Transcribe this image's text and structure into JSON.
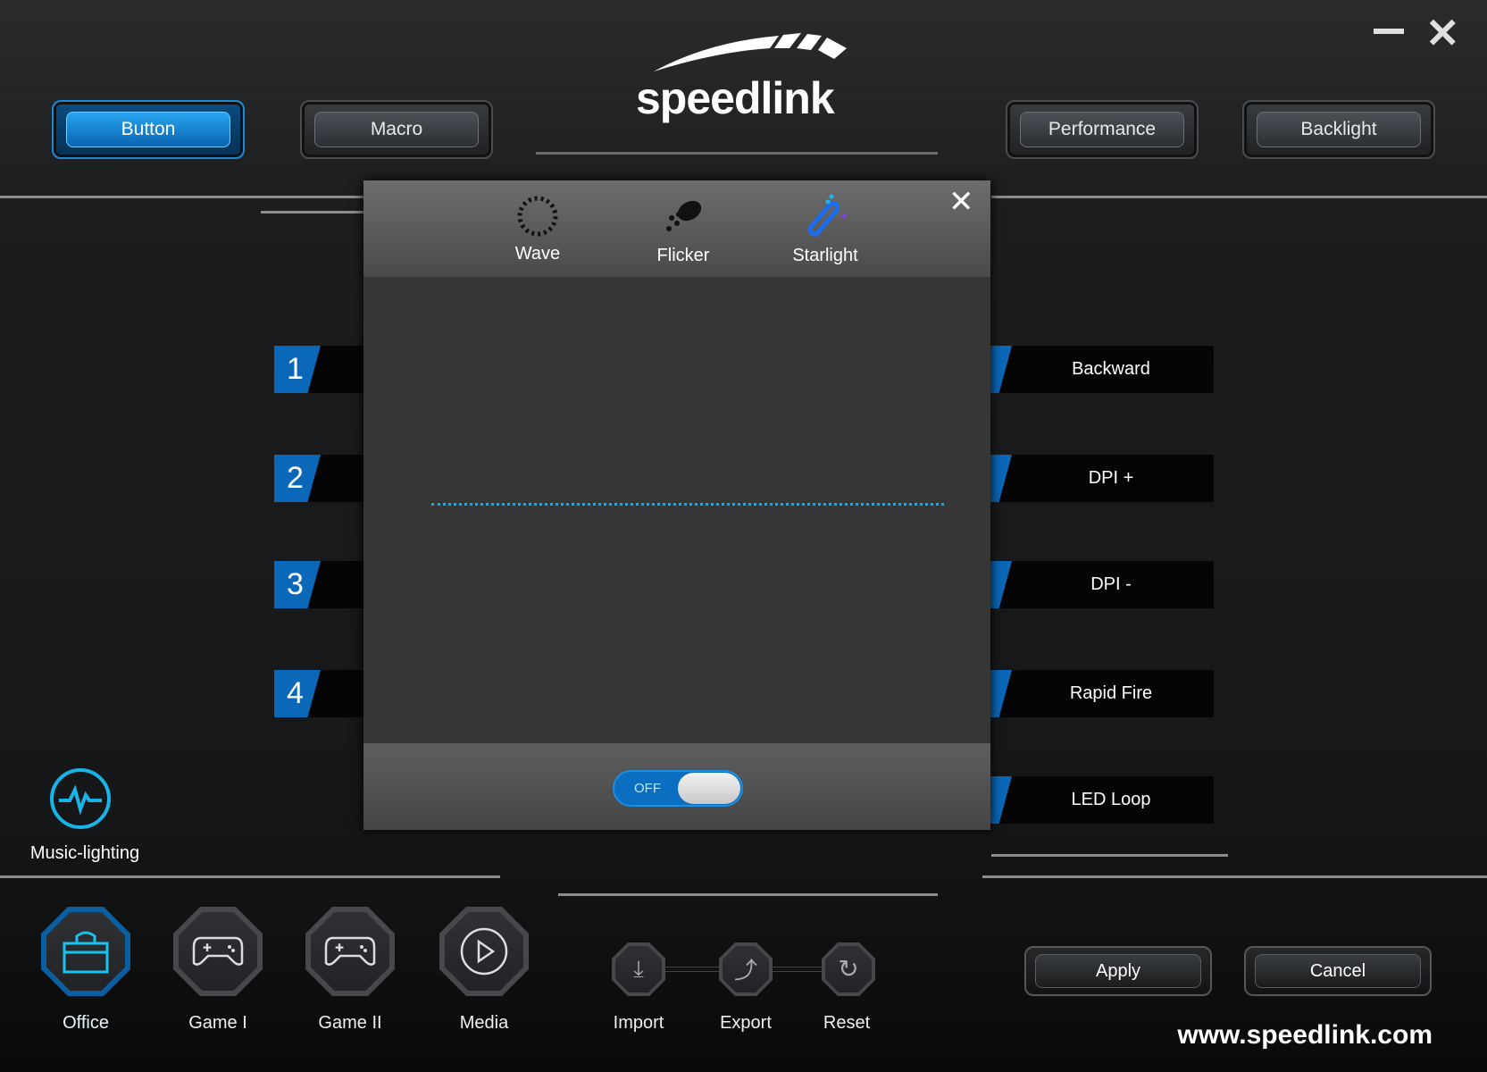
{
  "app": {
    "logo": "speedlink",
    "website": "www.speedlink.com"
  },
  "window": {
    "minimize_icon": "minimize-icon",
    "close_icon": "close-icon"
  },
  "tabs": [
    {
      "label": "Button",
      "active": true
    },
    {
      "label": "Macro"
    },
    {
      "label": "Performance"
    },
    {
      "label": "Backlight"
    }
  ],
  "left_buttons": [
    "1",
    "2",
    "3",
    "4"
  ],
  "right_buttons": [
    "Backward",
    "DPI +",
    "DPI -",
    "Rapid Fire",
    "LED Loop"
  ],
  "dialog": {
    "effects": [
      {
        "label": "Wave",
        "icon": "wave-icon"
      },
      {
        "label": "Flicker",
        "icon": "flicker-icon"
      },
      {
        "label": "Starlight",
        "icon": "starlight-icon"
      }
    ],
    "toggle": {
      "label": "OFF",
      "state": "off"
    },
    "accent": "#1aa8e8"
  },
  "music": {
    "label": "Music-lighting",
    "icon": "pulse-icon"
  },
  "profiles": [
    {
      "label": "Office",
      "active": true,
      "icon": "briefcase-icon"
    },
    {
      "label": "Game I",
      "icon": "gamepad-icon"
    },
    {
      "label": "Game II",
      "icon": "gamepad-icon"
    },
    {
      "label": "Media",
      "icon": "play-icon"
    }
  ],
  "actions": [
    {
      "label": "Import",
      "icon": "import-icon"
    },
    {
      "label": "Export",
      "icon": "export-icon"
    },
    {
      "label": "Reset",
      "icon": "reset-icon"
    }
  ],
  "footer": {
    "apply": "Apply",
    "cancel": "Cancel"
  }
}
